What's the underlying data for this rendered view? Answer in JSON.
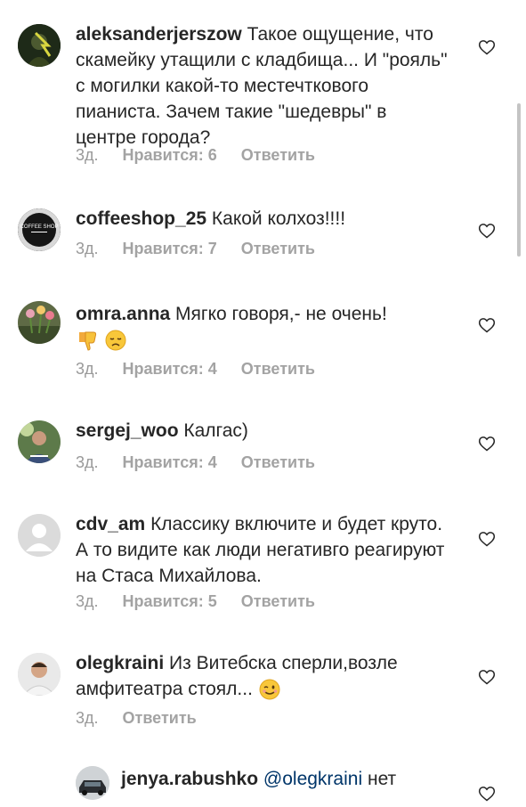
{
  "comments": [
    {
      "username": "aleksanderjerszow",
      "text": "Такое ощущение, что скамейку утащили с кладбища... И \"рояль\" с могилки какой-то местечткового пианиста. Зачем такие \"шедевры\" в центре города?",
      "time": "3д.",
      "likes": "Нравится: 6",
      "reply": "Ответить"
    },
    {
      "username": "coffeeshop_25",
      "text": "Какой колхоз!!!!",
      "avatar_text": "COFFEE SHOP",
      "time": "3д.",
      "likes": "Нравится: 7",
      "reply": "Ответить"
    },
    {
      "username": "omra.anna",
      "text": "Мягко говоря,- не очень!",
      "emoji": [
        "thumbs-down-emoji",
        "disappointed-face-emoji"
      ],
      "time": "3д.",
      "likes": "Нравится: 4",
      "reply": "Ответить"
    },
    {
      "username": "sergej_woo",
      "text": "Калгас)",
      "time": "3д.",
      "likes": "Нравится: 4",
      "reply": "Ответить"
    },
    {
      "username": "cdv_am",
      "text": "Классику включите и будет круто. А то видите как люди негативго реагируют на Стаса Михайлова.",
      "time": "3д.",
      "likes": "Нравится: 5",
      "reply": "Ответить"
    },
    {
      "username": "olegkraini",
      "text": "Из Витебска  сперли,возле амфитеатра стоял...",
      "emoji": [
        "winking-face-emoji"
      ],
      "time": "3д.",
      "reply": "Ответить"
    },
    {
      "username": "jenya.rabushko",
      "mention": "@olegkraini",
      "text": "нет"
    }
  ],
  "colors": {
    "text": "#262626",
    "meta": "#999999",
    "mention": "#003569",
    "divider": "#efefef"
  },
  "icons": {
    "like": "heart-outline-icon"
  }
}
